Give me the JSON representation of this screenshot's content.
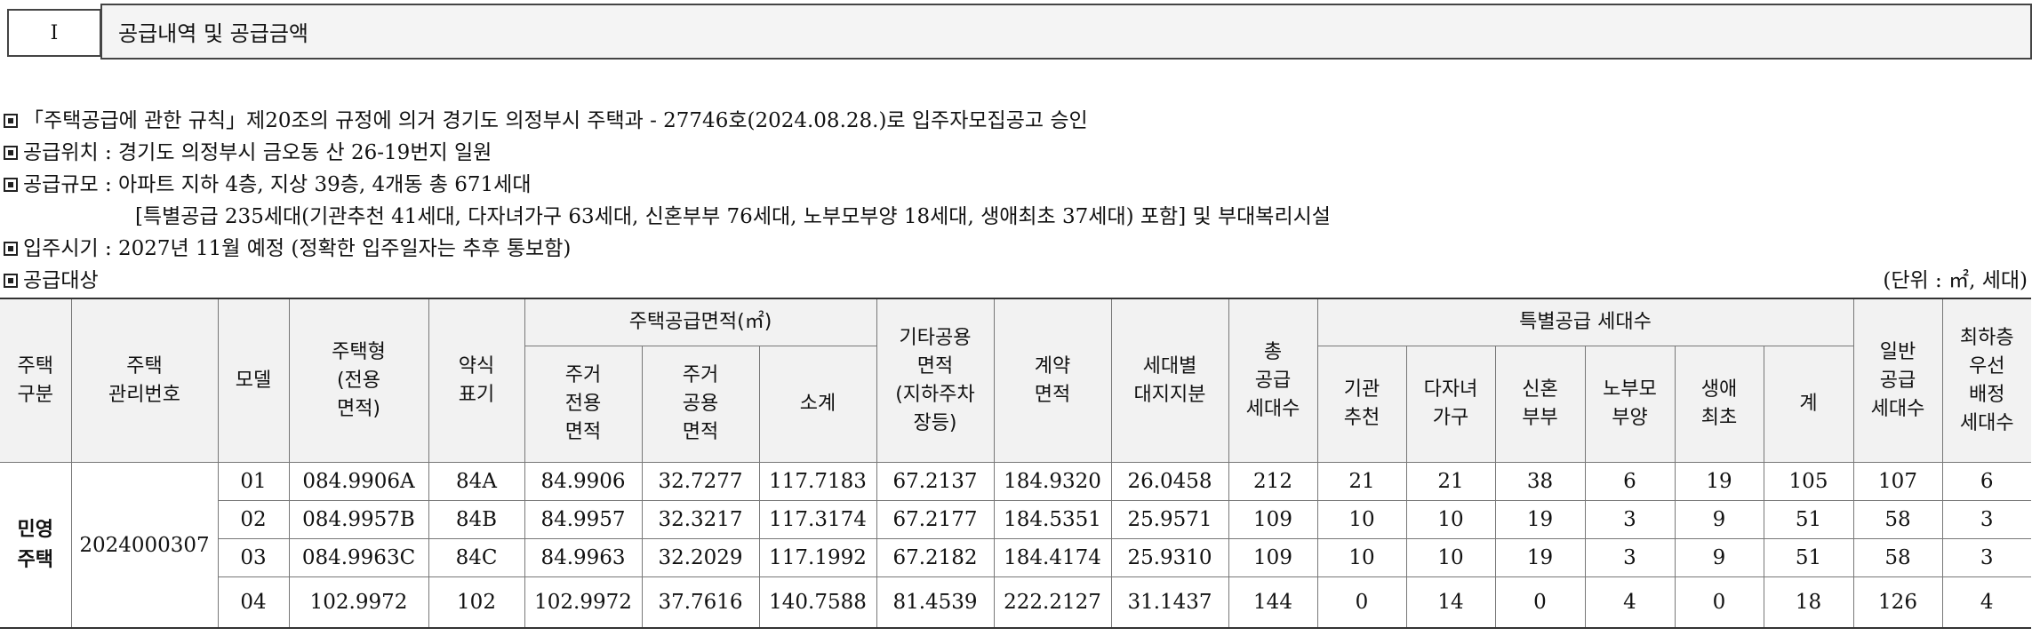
{
  "section": {
    "number": "I",
    "title": "공급내역 및 공급금액"
  },
  "info": {
    "line1": "「주택공급에 관한 규칙」제20조의 규정에 의거 경기도 의정부시 주택과 - 27746호(2024.08.28.)로 입주자모집공고 승인",
    "line2": "공급위치 : 경기도 의정부시 금오동 산 26-19번지 일원",
    "line3": "공급규모 : 아파트 지하 4층, 지상 39층, 4개동 총 671세대",
    "line4": "[특별공급 235세대(기관추천 41세대, 다자녀가구 63세대, 신혼부부 76세대, 노부모부양 18세대, 생애최초 37세대) 포함] 및 부대복리시설",
    "line5": "입주시기 : 2027년 11월 예정 (정확한 입주일자는 추후 통보함)",
    "line6": "공급대상",
    "unit": "(단위 : ㎡, 세대)"
  },
  "table": {
    "headers": {
      "type": "주택\n구분",
      "mgmt_no": "주택\n관리번호",
      "model": "모델",
      "housing_type": "주택형\n(전용\n면적)",
      "abbr": "약식\n표기",
      "supply_area": "주택공급면적(㎡)",
      "excl_area": "주거\n전용\n면적",
      "common_area": "주거\n공용\n면적",
      "subtotal": "소계",
      "other_common": "기타공용\n면적\n(지하주차\n장등)",
      "contract_area": "계약\n면적",
      "land_share": "세대별\n대지지분",
      "total_units": "총\n공급\n세대수",
      "special": "특별공급 세대수",
      "institution": "기관\n추천",
      "multi_child": "다자녀\n가구",
      "newlywed": "신혼\n부부",
      "elderly": "노부모\n부양",
      "first_life": "생애\n최초",
      "special_total": "계",
      "general": "일반\n공급\n세대수",
      "top_floor": "최하층\n우선\n배정\n세대수"
    },
    "group_label": "민영\n주택",
    "mgmt_number": "2024000307",
    "rows": [
      [
        "01",
        "084.9906A",
        "84A",
        "84.9906",
        "32.7277",
        "117.7183",
        "67.2137",
        "184.9320",
        "26.0458",
        "212",
        "21",
        "21",
        "38",
        "6",
        "19",
        "105",
        "107",
        "6"
      ],
      [
        "02",
        "084.9957B",
        "84B",
        "84.9957",
        "32.3217",
        "117.3174",
        "67.2177",
        "184.5351",
        "25.9571",
        "109",
        "10",
        "10",
        "19",
        "3",
        "9",
        "51",
        "58",
        "3"
      ],
      [
        "03",
        "084.9963C",
        "84C",
        "84.9963",
        "32.2029",
        "117.1992",
        "67.2182",
        "184.4174",
        "25.9310",
        "109",
        "10",
        "10",
        "19",
        "3",
        "9",
        "51",
        "58",
        "3"
      ],
      [
        "04",
        "102.9972",
        "102",
        "102.9972",
        "37.7616",
        "140.7588",
        "81.4539",
        "222.2127",
        "31.1437",
        "144",
        "0",
        "14",
        "0",
        "4",
        "0",
        "18",
        "126",
        "4"
      ]
    ]
  }
}
